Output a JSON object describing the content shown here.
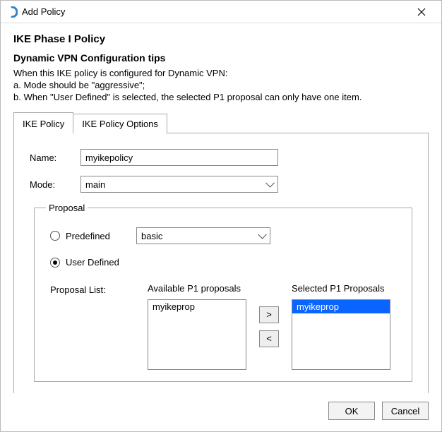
{
  "window": {
    "title": "Add Policy"
  },
  "heading": "IKE Phase I Policy",
  "tips": {
    "subheading": "Dynamic VPN Configuration tips",
    "intro": "When this IKE policy is configured for Dynamic VPN:",
    "a": "a. Mode should be \"aggressive\";",
    "b": "b. When \"User Defined\" is selected, the selected P1 proposal can  only have one item."
  },
  "tabs": {
    "active": "IKE Policy",
    "items": [
      "IKE Policy",
      "IKE Policy Options"
    ]
  },
  "form": {
    "name_label": "Name:",
    "name_value": "myikepolicy",
    "mode_label": "Mode:",
    "mode_value": "main"
  },
  "proposal": {
    "legend": "Proposal",
    "predefined_label": "Predefined",
    "predefined_value": "basic",
    "userdefined_label": "User Defined",
    "selected_radio": "userdefined",
    "list_label": "Proposal List:",
    "available_heading": "Available P1 proposals",
    "available_items": [
      "myikeprop"
    ],
    "selected_heading": "Selected P1 Proposals",
    "selected_items": [
      "myikeprop"
    ],
    "arrow_add": ">",
    "arrow_remove": "<"
  },
  "footer": {
    "ok_label": "OK",
    "cancel_label": "Cancel"
  }
}
